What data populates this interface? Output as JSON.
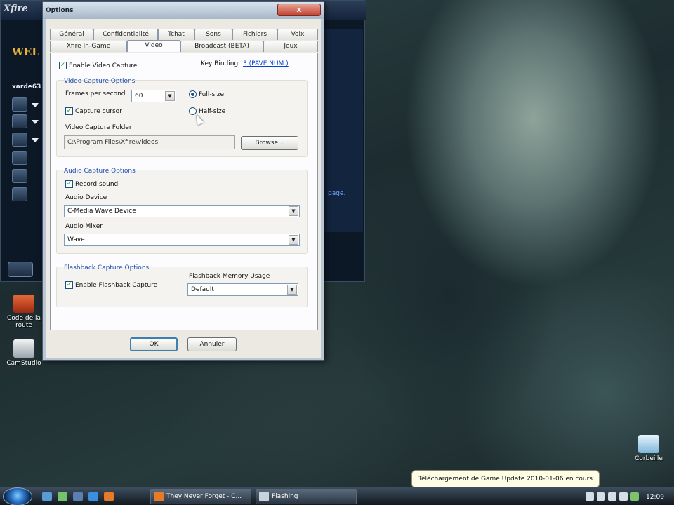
{
  "dialog": {
    "title": "Options",
    "close_label": "x",
    "tabs_row1": [
      "Général",
      "Confidentialité",
      "Tchat",
      "Sons",
      "Fichiers",
      "Voix"
    ],
    "tabs_row2": [
      "Xfire In-Game",
      "Video",
      "Broadcast (BETA)",
      "Jeux"
    ],
    "active_tab": "Video",
    "enable_video_capture": {
      "label": "Enable Video Capture",
      "checked": true
    },
    "key_binding": {
      "label": "Key Binding:",
      "value": "3 (PAVE NUM.)"
    },
    "video_capture": {
      "title": "Video Capture Options",
      "fps_label": "Frames per second",
      "fps_value": "60",
      "full_size_label": "Full-size",
      "half_size_label": "Half-size",
      "size_selected": "Full-size",
      "capture_cursor": {
        "label": "Capture cursor",
        "checked": true
      },
      "folder_label": "Video Capture Folder",
      "folder_value": "C:\\Program Files\\Xfire\\videos",
      "browse_label": "Browse..."
    },
    "audio_capture": {
      "title": "Audio Capture Options",
      "record_sound": {
        "label": "Record sound",
        "checked": true
      },
      "device_label": "Audio Device",
      "device_value": "C-Media Wave Device",
      "mixer_label": "Audio Mixer",
      "mixer_value": "Wave"
    },
    "flashback": {
      "title": "Flashback Capture Options",
      "enable": {
        "label": "Enable Flashback Capture",
        "checked": true
      },
      "memory_label": "Flashback Memory Usage",
      "memory_value": "Default"
    },
    "ok_label": "OK",
    "cancel_label": "Annuler"
  },
  "xfire": {
    "logo": "Xfire",
    "welcome": "WEL",
    "username": "xarde63",
    "side_link": "page."
  },
  "desktop": {
    "icons": [
      {
        "name": "Code de la route",
        "line1": "Code de la",
        "line2": "route"
      },
      {
        "name": "CamStudio",
        "line1": "CamStudio",
        "line2": ""
      },
      {
        "name": "Corbeille",
        "line1": "Corbeille",
        "line2": ""
      }
    ]
  },
  "taskbar": {
    "tasks": [
      {
        "label": "They Never Forget - C..."
      },
      {
        "label": "Flashing"
      }
    ],
    "notification": "Téléchargement de Game Update 2010-01-06 en cours",
    "clock": "12:09"
  },
  "colors": {
    "accent": "#1f4fb3",
    "dialog_bg": "#ece9e2",
    "ok_border": "#3c7fb1"
  }
}
